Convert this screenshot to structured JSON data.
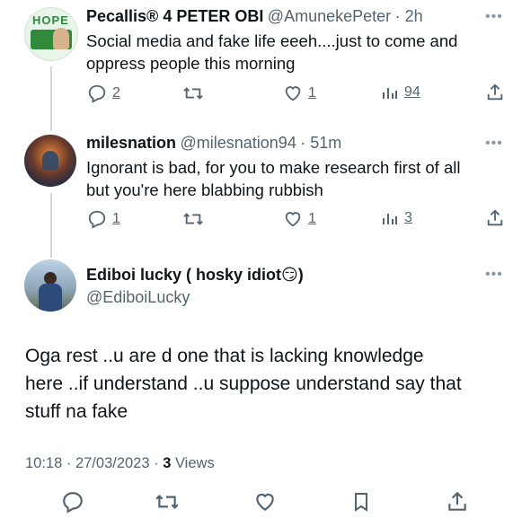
{
  "tweets": [
    {
      "name": "Pecallis® 4 PETER OBI",
      "handle": "@AmunekePeter",
      "time": "· 2h",
      "text1": "Social media and fake life eeeh....just to come and",
      "text2": "oppress people this morning",
      "replies": "2",
      "retweets": "",
      "likes": "1",
      "views": "94",
      "avatar_text": "HOPE"
    },
    {
      "name": "milesnation",
      "handle": "@milesnation94",
      "time": "· 51m",
      "text1": "Ignorant is bad, for you to make research first of all",
      "text2": "but you're here blabbing rubbish",
      "replies": "1",
      "retweets": "",
      "likes": "1",
      "views": "3"
    }
  ],
  "main": {
    "name": "Ediboi lucky ( hosky idiot😏)",
    "handle": "@EdiboiLucky",
    "text1": "Oga rest ..u are d one that is lacking knowledge",
    "text2": "here ..if understand ..u suppose understand say that",
    "text3": "stuff na fake",
    "timestamp": "10:18 · 27/03/2023 · ",
    "views_count": "3",
    "views_label": " Views"
  },
  "colors": {
    "text": "#0f1419",
    "secondary": "#536471",
    "line": "#cfd9de"
  }
}
